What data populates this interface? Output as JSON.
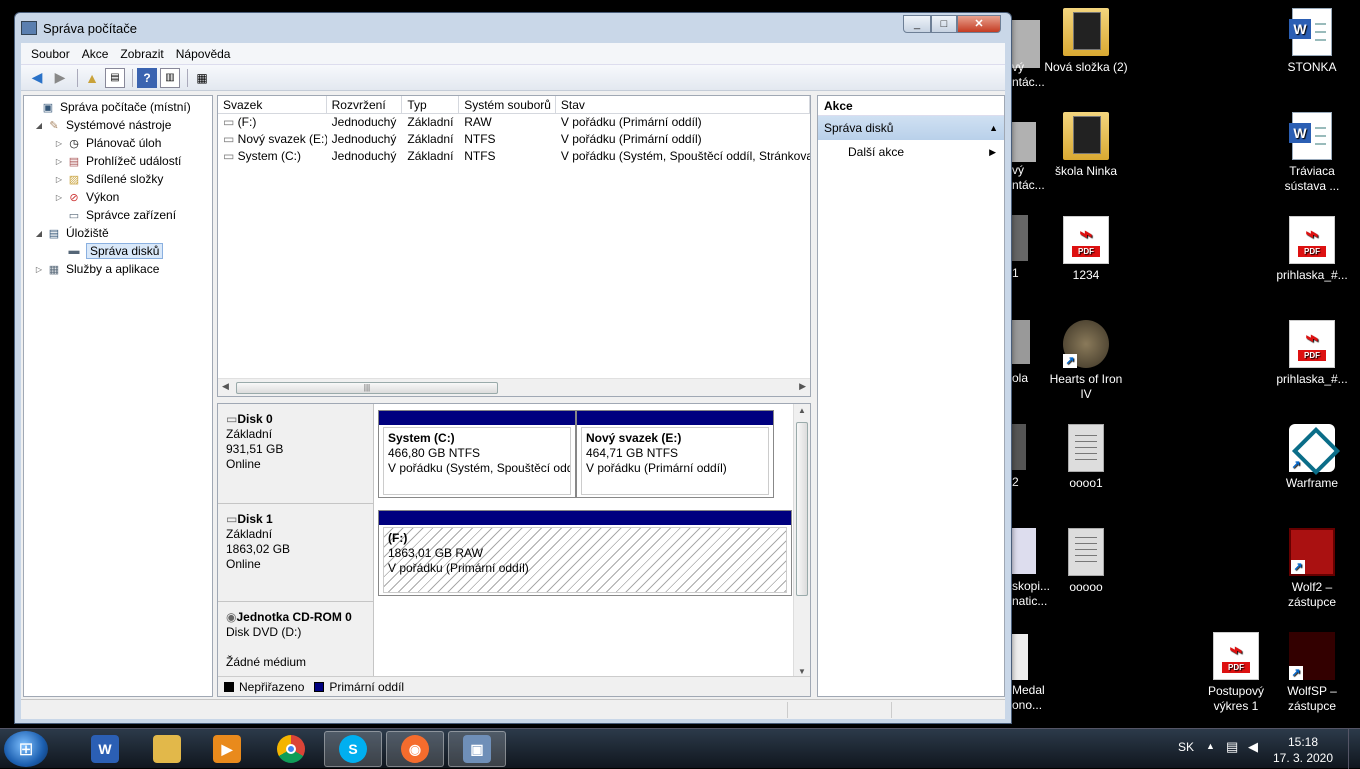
{
  "window": {
    "title": "Správa počítače",
    "controls": {
      "minimize": "_",
      "maximize": "□",
      "close": "✕"
    }
  },
  "menubar": [
    "Soubor",
    "Akce",
    "Zobrazit",
    "Nápověda"
  ],
  "toolbar": [
    "back-icon",
    "forward-icon",
    "up-folder-icon",
    "show-hide-tree-icon",
    "help-icon",
    "show-hide-actions-icon",
    "properties-icon"
  ],
  "tree": [
    {
      "label": "Správa počítače (místní)",
      "indent": 0,
      "expander": ""
    },
    {
      "label": "Systémové nástroje",
      "indent": 1,
      "expander": "◢"
    },
    {
      "label": "Plánovač úloh",
      "indent": 2,
      "expander": "▷"
    },
    {
      "label": "Prohlížeč událostí",
      "indent": 2,
      "expander": "▷"
    },
    {
      "label": "Sdílené složky",
      "indent": 2,
      "expander": "▷"
    },
    {
      "label": "Výkon",
      "indent": 2,
      "expander": "▷"
    },
    {
      "label": "Správce zařízení",
      "indent": 2,
      "expander": ""
    },
    {
      "label": "Úložiště",
      "indent": 1,
      "expander": "◢"
    },
    {
      "label": "Správa disků",
      "indent": 2,
      "expander": "",
      "selected": true
    },
    {
      "label": "Služby a aplikace",
      "indent": 1,
      "expander": "▷"
    }
  ],
  "volumes": {
    "columns": [
      "Svazek",
      "Rozvržení",
      "Typ",
      "Systém souborů",
      "Stav"
    ],
    "rows": [
      [
        "(F:)",
        "Jednoduchý",
        "Základní",
        "RAW",
        "V pořádku (Primární oddíl)"
      ],
      [
        "Nový svazek (E:)",
        "Jednoduchý",
        "Základní",
        "NTFS",
        "V pořádku (Primární oddíl)"
      ],
      [
        "System (C:)",
        "Jednoduchý",
        "Základní",
        "NTFS",
        "V pořádku (Systém, Spouštěcí oddíl, Stránkovac"
      ]
    ],
    "scroll_thumb": "|||"
  },
  "disks": [
    {
      "name": "Disk 0",
      "type": "Základní",
      "size": "931,51 GB",
      "status": "Online",
      "partitions": [
        {
          "name": "System  (C:)",
          "size": "466,80 GB NTFS",
          "status": "V pořádku (Systém, Spouštěcí oddí"
        },
        {
          "name": "Nový svazek  (E:)",
          "size": "464,71 GB NTFS",
          "status": "V pořádku (Primární oddíl)"
        }
      ]
    },
    {
      "name": "Disk 1",
      "type": "Základní",
      "size": "1863,02 GB",
      "status": "Online",
      "partitions": [
        {
          "name": "(F:)",
          "size": "1863,01 GB RAW",
          "status": "V pořádku (Primární oddíl)"
        }
      ]
    },
    {
      "name": "Jednotka CD-ROM 0",
      "type": "Disk DVD (D:)",
      "size": "",
      "status": "Žádné médium",
      "partitions": []
    }
  ],
  "legend": [
    {
      "label": "Nepřiřazeno",
      "color": "#000000"
    },
    {
      "label": "Primární oddíl",
      "color": "#00007f"
    }
  ],
  "actions": {
    "header": "Akce",
    "section": "Správa disků",
    "more": "Další akce"
  },
  "desktop_icons": [
    {
      "label": "Nová složka (2)",
      "icon": "folder-icon"
    },
    {
      "label": "škola Ninka",
      "icon": "folder-icon"
    },
    {
      "label": "1234",
      "icon": "pdf-icon"
    },
    {
      "label": "Hearts of Iron IV",
      "icon": "game-icon"
    },
    {
      "label": "oooo1",
      "icon": "image-icon"
    },
    {
      "label": "ooooo",
      "icon": "image-icon"
    },
    {
      "label": "STONKA",
      "icon": "word-doc-icon"
    },
    {
      "label": "Tráviaca sústava ...",
      "icon": "word-doc-icon"
    },
    {
      "label": "prihlaska_#...",
      "icon": "pdf-icon"
    },
    {
      "label": "prihlaska_#...",
      "icon": "pdf-icon"
    },
    {
      "label": "Warframe",
      "icon": "game-icon"
    },
    {
      "label": "Wolf2 – zástupce",
      "icon": "game-icon"
    },
    {
      "label": "WolfSP – zástupce",
      "icon": "game-icon"
    },
    {
      "label": "Postupový výkres 1",
      "icon": "pdf-icon"
    }
  ],
  "partial_labels": [
    "vý",
    "ntác...",
    "vý",
    "ntác...",
    "1",
    "ola",
    "2",
    "skopi...",
    "natic...",
    "Medal",
    "ono..."
  ],
  "taskbar": {
    "apps": [
      "word-icon",
      "explorer-icon",
      "media-player-icon",
      "chrome-icon",
      "skype-icon",
      "origin-icon",
      "computer-management-icon"
    ],
    "language": "SK",
    "time": "15:18",
    "date": "17. 3. 2020"
  }
}
